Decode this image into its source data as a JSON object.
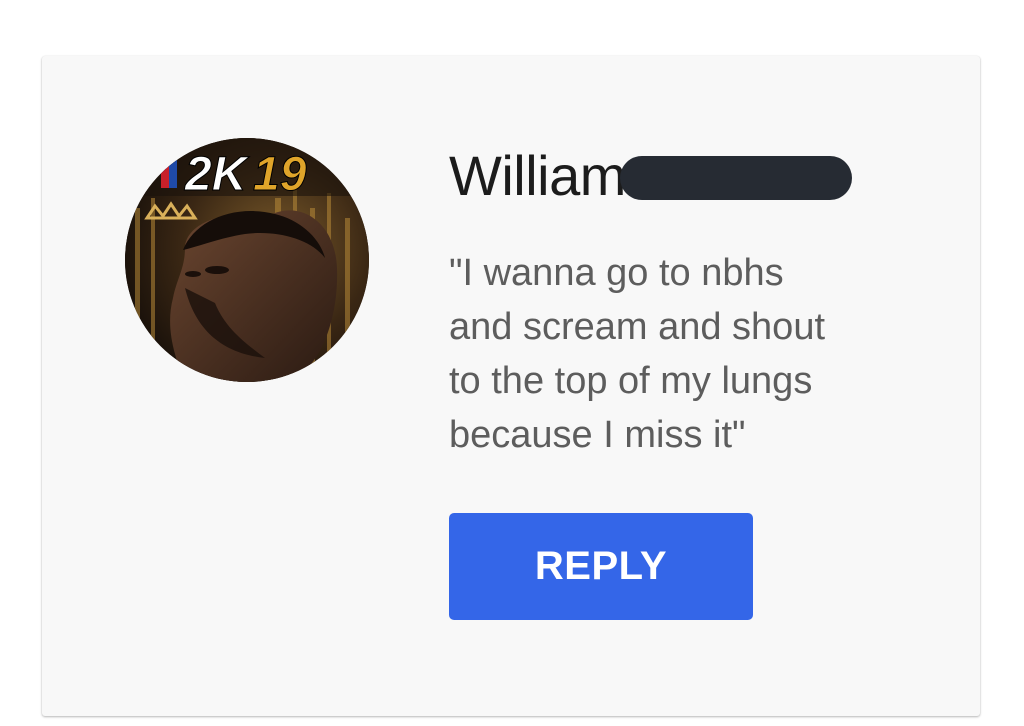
{
  "comment": {
    "author_name": "William",
    "author_name_redacted": true,
    "avatar": {
      "icon": "game-cover-avatar",
      "badge_text": "2K19"
    },
    "message": "\"I wanna go to nbhs\nand scream and shout\nto the top of my lungs\nbecause I miss it\"",
    "reply_label": "REPLY"
  },
  "colors": {
    "card_background": "#f8f8f8",
    "reply_button": "#3466e8",
    "name_text": "#1c1c1c",
    "message_text": "#5d5d5d",
    "redaction": "#262b33"
  }
}
